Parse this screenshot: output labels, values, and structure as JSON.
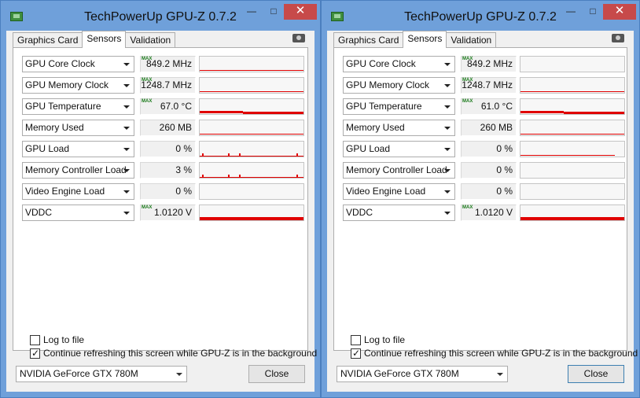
{
  "windows": [
    {
      "title": "TechPowerUp GPU-Z 0.7.2",
      "tabs": [
        "Graphics Card",
        "Sensors",
        "Validation"
      ],
      "active_tab": "Sensors",
      "sensors": [
        {
          "label": "GPU Core Clock",
          "max": true,
          "value": "849.2 MHz",
          "graph": {
            "type": "thin-line",
            "level": 0.15
          }
        },
        {
          "label": "GPU Memory Clock",
          "max": true,
          "value": "1248.7 MHz",
          "graph": {
            "type": "thin-line",
            "level": 0.15
          }
        },
        {
          "label": "GPU Temperature",
          "max": true,
          "value": "67.0 °C",
          "graph": {
            "type": "thick-line",
            "level": 0.12
          }
        },
        {
          "label": "Memory Used",
          "max": false,
          "value": "260 MB",
          "graph": {
            "type": "thin-line",
            "level": 0.12
          }
        },
        {
          "label": "GPU Load",
          "max": false,
          "value": "0 %",
          "graph": {
            "type": "spikes",
            "level": 0.1
          }
        },
        {
          "label": "Memory Controller Load",
          "max": false,
          "value": "3 %",
          "graph": {
            "type": "spikes",
            "level": 0.1
          }
        },
        {
          "label": "Video Engine Load",
          "max": false,
          "value": "0 %",
          "graph": {
            "type": "empty",
            "level": 0
          }
        },
        {
          "label": "VDDC",
          "max": true,
          "value": "1.0120 V",
          "graph": {
            "type": "thick-bar",
            "level": 0.2
          }
        }
      ],
      "log_to_file": {
        "label": "Log to file",
        "checked": false
      },
      "continue_refresh": {
        "label": "Continue refreshing this screen while GPU-Z is in the background",
        "checked": true
      },
      "gpu_select": "NVIDIA GeForce GTX 780M",
      "close_label": "Close"
    },
    {
      "title": "TechPowerUp GPU-Z 0.7.2",
      "tabs": [
        "Graphics Card",
        "Sensors",
        "Validation"
      ],
      "active_tab": "Sensors",
      "sensors": [
        {
          "label": "GPU Core Clock",
          "max": true,
          "value": "849.2 MHz",
          "graph": {
            "type": "empty",
            "level": 0
          }
        },
        {
          "label": "GPU Memory Clock",
          "max": true,
          "value": "1248.7 MHz",
          "graph": {
            "type": "thin-line",
            "level": 0.15
          }
        },
        {
          "label": "GPU Temperature",
          "max": true,
          "value": "61.0 °C",
          "graph": {
            "type": "thick-line",
            "level": 0.12
          }
        },
        {
          "label": "Memory Used",
          "max": false,
          "value": "260 MB",
          "graph": {
            "type": "thin-line",
            "level": 0.12
          }
        },
        {
          "label": "GPU Load",
          "max": false,
          "value": "0 %",
          "graph": {
            "type": "thin-line-short",
            "level": 0.1
          }
        },
        {
          "label": "Memory Controller Load",
          "max": false,
          "value": "0 %",
          "graph": {
            "type": "empty",
            "level": 0
          }
        },
        {
          "label": "Video Engine Load",
          "max": false,
          "value": "0 %",
          "graph": {
            "type": "empty",
            "level": 0
          }
        },
        {
          "label": "VDDC",
          "max": true,
          "value": "1.0120 V",
          "graph": {
            "type": "thick-bar",
            "level": 0.2
          }
        }
      ],
      "log_to_file": {
        "label": "Log to file",
        "checked": false
      },
      "continue_refresh": {
        "label": "Continue refreshing this screen while GPU-Z is in the background",
        "checked": true
      },
      "gpu_select": "NVIDIA GeForce GTX 780M",
      "close_label": "Close"
    }
  ],
  "max_tag": "MAX",
  "icons": {
    "app": "gpuz-card-icon",
    "camera": "camera-icon",
    "minimize": "minimize-icon",
    "maximize": "maximize-icon",
    "close": "close-icon"
  },
  "colors": {
    "graph_line": "#e00000",
    "max_tag": "#1a7a1a",
    "titlebar": "#6fa0da",
    "close_button": "#c74a4a"
  }
}
